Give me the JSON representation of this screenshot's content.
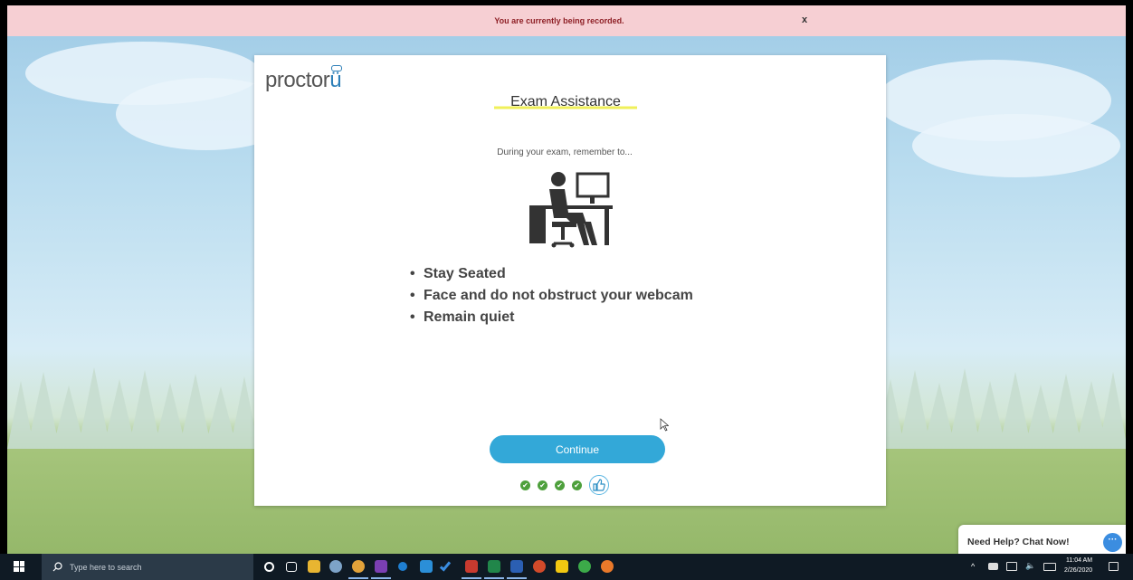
{
  "recording_bar": {
    "message": "You are currently being recorded.",
    "close_label": "x"
  },
  "modal": {
    "logo_text": "proctor",
    "logo_u": "ü",
    "title": "Exam Assistance",
    "intro": "During your exam, remember to...",
    "tips": [
      "Stay Seated",
      "Face and do not obstruct your webcam",
      "Remain quiet"
    ],
    "continue_label": "Continue",
    "progress_completed": 4
  },
  "chat": {
    "label": "Need Help? Chat Now!"
  },
  "taskbar": {
    "search_placeholder": "Type here to search",
    "time": "11:04 AM",
    "date": "2/26/2020"
  },
  "colors": {
    "accent": "#33a8d8",
    "recording_bar": "#f6cfd3",
    "success": "#4ea03c",
    "highlight": "#f0f05a"
  }
}
